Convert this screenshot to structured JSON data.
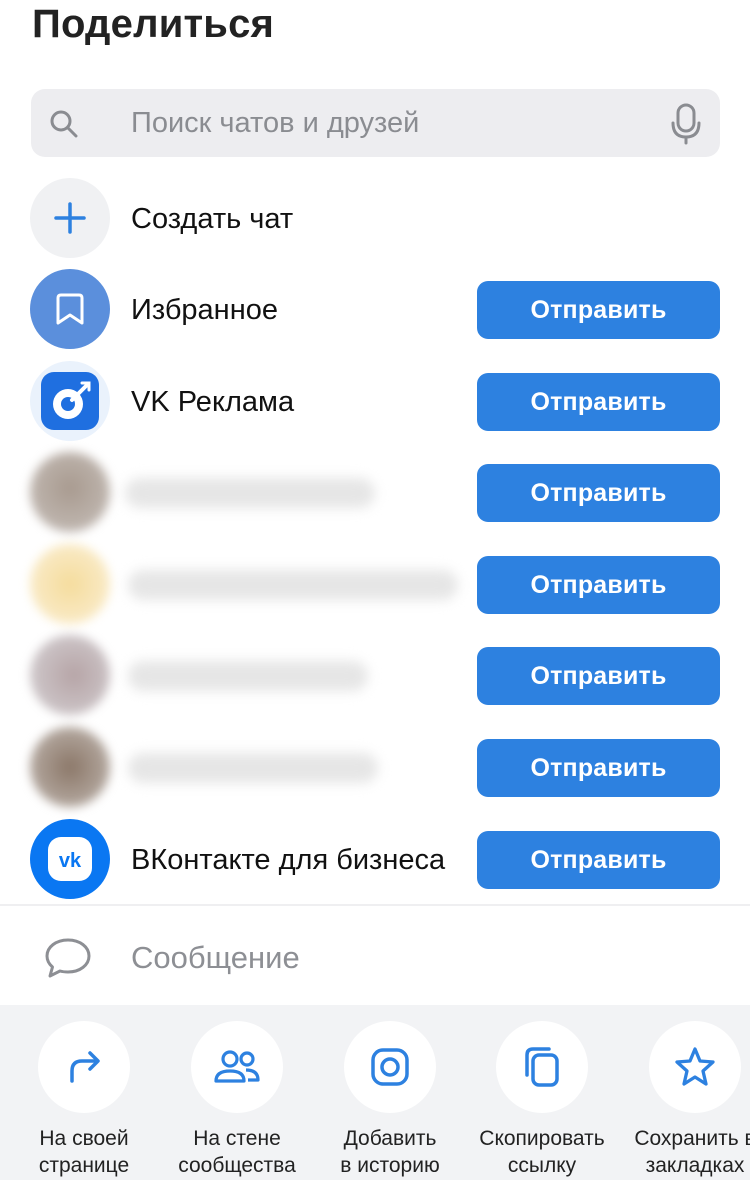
{
  "header": {
    "title": "Поделиться"
  },
  "search": {
    "placeholder": "Поиск чатов и друзей",
    "icon": "search-icon",
    "mic_icon": "microphone-icon"
  },
  "create_chat": {
    "label": "Создать чат",
    "icon": "plus-icon"
  },
  "contacts": [
    {
      "name": "Избранное",
      "icon": "bookmark-icon",
      "button": "Отправить"
    },
    {
      "name": "VK Реклама",
      "icon": "vk-ads-logo",
      "button": "Отправить"
    },
    {
      "name": "",
      "button": "Отправить"
    },
    {
      "name": "",
      "button": "Отправить"
    },
    {
      "name": "",
      "button": "Отправить"
    },
    {
      "name": "",
      "button": "Отправить"
    },
    {
      "name": "ВКонтакте для бизнеса",
      "icon": "vk-logo",
      "button": "Отправить"
    }
  ],
  "message": {
    "placeholder": "Сообщение",
    "icon": "chat-bubble-icon"
  },
  "actions": [
    {
      "label": "На своей\nстранице",
      "icon": "share-arrow-icon"
    },
    {
      "label": "На стене\nсообщества",
      "icon": "users-icon"
    },
    {
      "label": "Добавить\nв историю",
      "icon": "story-icon"
    },
    {
      "label": "Скопировать\nссылку",
      "icon": "copy-icon"
    },
    {
      "label": "Сохранить в\nзакладках",
      "icon": "star-icon"
    }
  ],
  "colors": {
    "accent": "#2d81e0",
    "favorites_avatar": "#5b8fdc",
    "vk_blue": "#0a77f2"
  }
}
